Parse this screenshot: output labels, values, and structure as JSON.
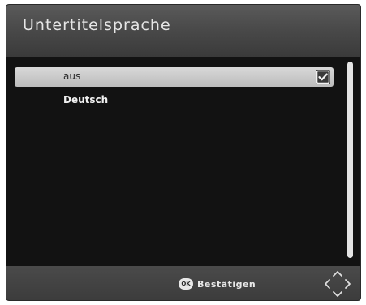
{
  "dialog": {
    "title": "Untertitelsprache"
  },
  "options": [
    {
      "label": "aus",
      "selected": true
    },
    {
      "label": "Deutsch",
      "selected": false
    }
  ],
  "footer": {
    "ok_key": "OK",
    "confirm_label": "Bestätigen",
    "nav_icon": "dpad-arrows-icon"
  },
  "colors": {
    "panel_background": "#121212",
    "header_background": "#4a4a4a",
    "selected_row": "#c8c8c8",
    "text": "#f0f0f0"
  }
}
